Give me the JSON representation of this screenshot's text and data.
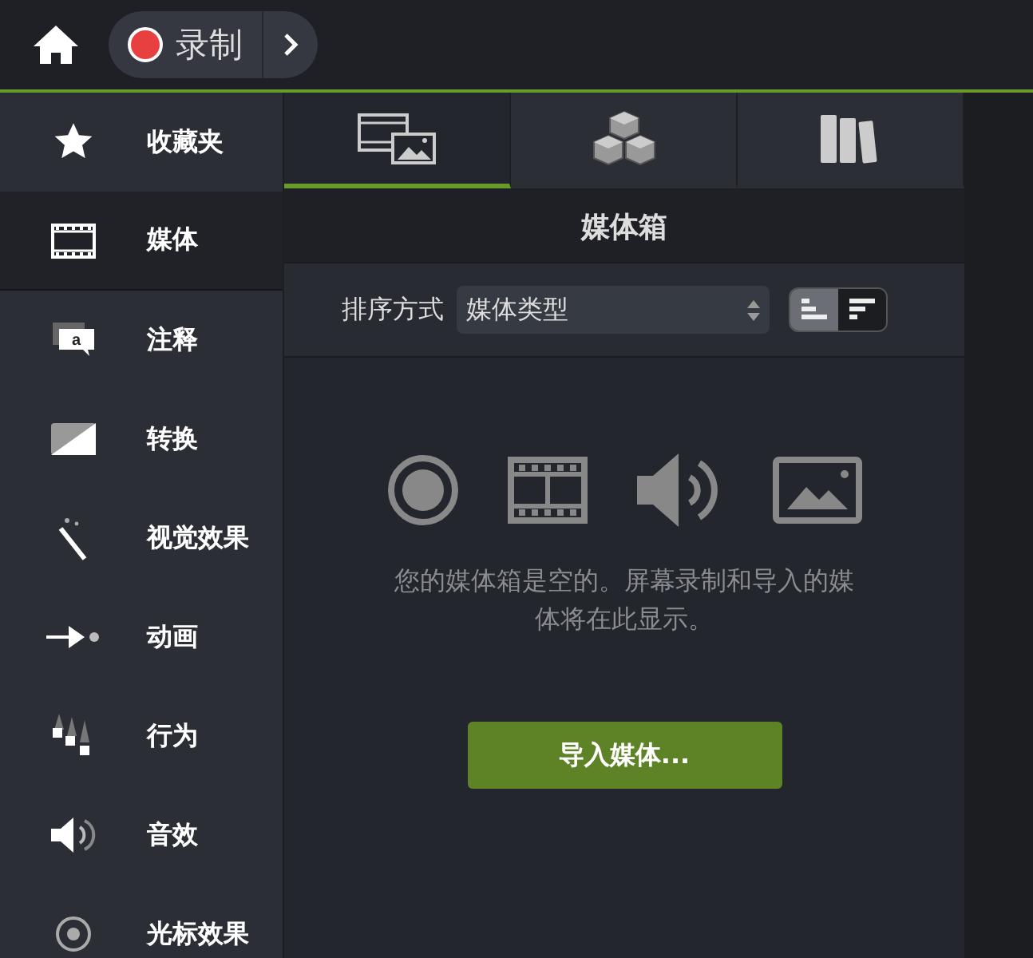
{
  "toolbar": {
    "record_label": "录制"
  },
  "sidebar": {
    "items": [
      {
        "kind": "star",
        "label": "收藏夹",
        "selected": false
      },
      {
        "kind": "film",
        "label": "媒体",
        "selected": true
      },
      {
        "kind": "annotation",
        "label": "注释",
        "icon_text": "a",
        "selected": false
      },
      {
        "kind": "transition",
        "label": "转换",
        "selected": false
      },
      {
        "kind": "wand",
        "label": "视觉效果",
        "selected": false
      },
      {
        "kind": "arrow",
        "label": "动画",
        "selected": false
      },
      {
        "kind": "behavior",
        "label": "行为",
        "selected": false
      },
      {
        "kind": "audio",
        "label": "音效",
        "selected": false
      },
      {
        "kind": "cursor",
        "label": "光标效果",
        "selected": false
      }
    ]
  },
  "tabs": [
    {
      "kind": "media",
      "selected": true
    },
    {
      "kind": "cubes",
      "selected": false
    },
    {
      "kind": "books",
      "selected": false
    }
  ],
  "panel": {
    "title": "媒体箱",
    "sort_label": "排序方式",
    "sort_value": "媒体类型",
    "view_modes": [
      {
        "kind": "bars-left",
        "selected": true
      },
      {
        "kind": "bars-right",
        "selected": false
      }
    ],
    "empty_message": "您的媒体箱是空的。屏幕录制和导入的媒体将在此显示。",
    "import_button": "导入媒体..."
  }
}
